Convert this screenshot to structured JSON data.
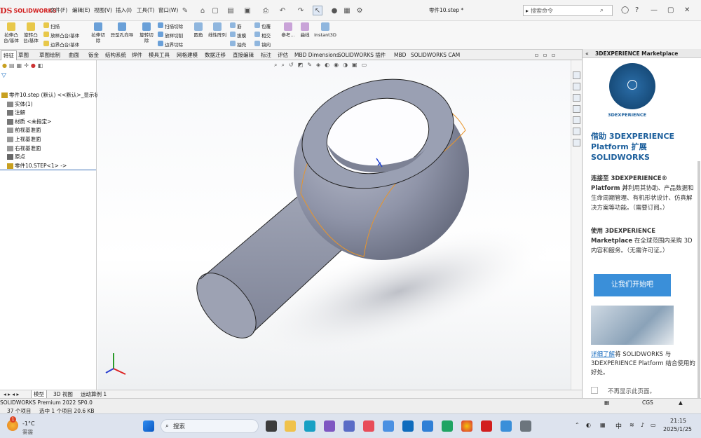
{
  "app": {
    "logo_text": "SOLIDWORKS",
    "document_title": "零件10.step *"
  },
  "menu": {
    "items": [
      "文件(F)",
      "编辑(E)",
      "视图(V)",
      "插入(I)",
      "工具(T)",
      "窗口(W)"
    ]
  },
  "search": {
    "placeholder": "搜索命令"
  },
  "ribbon": {
    "extrude_boss": "拉伸凸\n台/基体",
    "revolve_boss": "旋转凸\n台/基体",
    "sweep": "扫描",
    "loft": "放样凸台/基体",
    "boundary": "边界凸台/基体",
    "extrude_cut": "拉伸切\n除",
    "hole_wizard": "异型孔向导",
    "revolve_cut": "旋转切\n除",
    "swept_cut": "扫描切除",
    "lofted_cut": "放样切割",
    "boundary_cut": "边界切除",
    "fillet": "圆角",
    "linear_pattern": "线性阵列",
    "rib": "筋",
    "draft": "拔模",
    "shell": "抽壳",
    "wrap": "包覆",
    "intersect": "相交",
    "mirror": "镜向",
    "reference": "参考...",
    "curves": "曲线",
    "instant3d": "Instant3D"
  },
  "tabs": [
    "特征",
    "草图",
    "草图绘制",
    "曲面",
    "钣金",
    "结构系统",
    "焊件",
    "模具工具",
    "网格建模",
    "数据迁移",
    "直接编辑",
    "标注",
    "评估",
    "MBD Dimensions",
    "SOLIDWORKS 插件",
    "MBD",
    "SOLIDWORKS CAM"
  ],
  "tree": {
    "root": "零件10.step (默认) <<默认>_显示状",
    "items": [
      "实体(1)",
      "注解",
      "材质 <未指定>",
      "前视基准面",
      "上视基准面",
      "右视基准面",
      "原点",
      "零件10.STEP<1> ->"
    ]
  },
  "taskpane": {
    "title": "3DEXPERIENCE Marketplace",
    "logo_text": "3DEXPERIENCE",
    "heading": "借助 3DEXPERIENCE Platform 扩展 SOLIDWORKS",
    "p1_bold": "连接至 3DEXPERIENCE® Platform 并",
    "p1": "利用其协助、产品数据和生命周期管理、有机形状设计、仿真解决方案等功能。（需要订阅。）",
    "p2_bold": "使用 3DEXPERIENCE Marketplace",
    "p2": "在全球范围内采购 3D 内容和服务。（无需许可证。）",
    "cta": "让我们开始吧",
    "learn_link": "详细了解",
    "learn_text": "将 SOLIDWORKS 与 3DEXPERIENCE Platform 结合使用的好处。",
    "dont_show": "不再显示此页面。"
  },
  "bottom_tabs": [
    "模型",
    "3D 视图",
    "运动算例 1"
  ],
  "status": {
    "version": "SOLIDWORKS Premium 2022 SP0.0",
    "items": "37 个项目",
    "selected": "选中 1 个项目 20.6 KB",
    "units": "CGS"
  },
  "taskbar": {
    "weather_temp": "-1°C",
    "weather_desc": "雾霾",
    "search": "搜索",
    "ime": "中",
    "time": "21:15",
    "date": "2025/1/25",
    "badge": "1"
  },
  "colors": {
    "accent": "#3a8fd9",
    "brand": "#d21e1e",
    "model": "#8f94a8"
  }
}
